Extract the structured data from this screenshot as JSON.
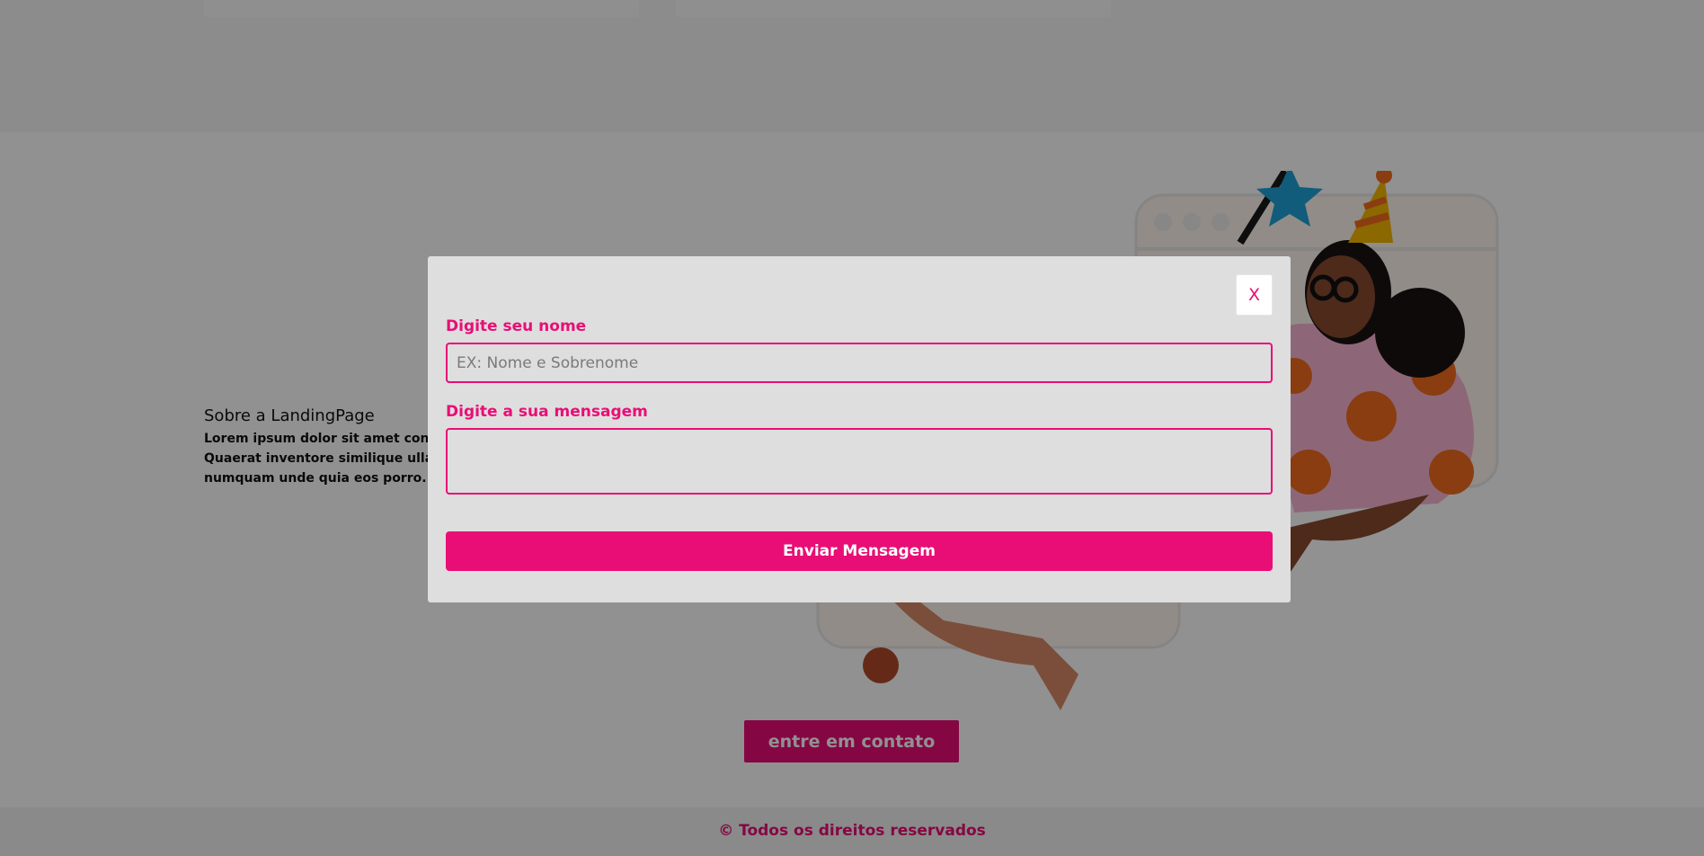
{
  "about": {
    "title": "Sobre a LandingPage",
    "text": "Lorem ipsum dolor sit amet consectetur adipisicing elit. Quaerat inventore similique ullam facere quisquam culpa numquam unde quia eos porro."
  },
  "contact_button": {
    "label": "entre em contato"
  },
  "footer": {
    "text": "© Todos os direitos reservados"
  },
  "modal": {
    "close_label": "X",
    "name_label": "Digite seu nome",
    "name_placeholder": "EX: Nome e Sobrenome",
    "name_value": "",
    "message_label": "Digite a sua mensagem",
    "message_value": "",
    "submit_label": "Enviar Mensagem"
  },
  "colors": {
    "accent": "#e90e76",
    "overlay": "rgba(0,0,0,0.43)",
    "modal_bg": "#dedede"
  },
  "illustration": {
    "subject": "party-person-with-star-wand-illustration"
  }
}
